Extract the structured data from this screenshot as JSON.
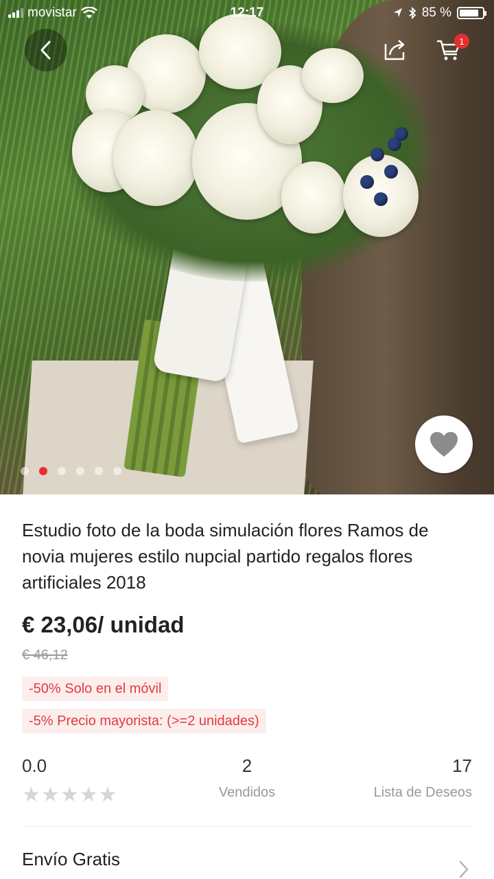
{
  "status_bar": {
    "carrier": "movistar",
    "time": "12:17",
    "battery": "85 %",
    "battery_level": 0.85
  },
  "header": {
    "cart_count": "1",
    "back_icon": "chevron-left-icon",
    "share_icon": "share-icon",
    "cart_icon": "cart-icon"
  },
  "gallery": {
    "image_count": 6,
    "active_index": 1,
    "favorite_icon": "heart-icon"
  },
  "product": {
    "title": "Estudio foto de la boda simulación flores Ramos de novia mujeres estilo nupcial partido regalos flores artificiales 2018",
    "price": "€ 23,06/ unidad",
    "original_price": "€ 46,12",
    "promotions": [
      "-50% Solo en el móvil",
      "-5% Precio mayorista: (>=2 unidades)"
    ]
  },
  "stats": {
    "rating": "0.0",
    "rating_value": 0,
    "sold_count": "2",
    "sold_label": "Vendidos",
    "wishlist_count": "17",
    "wishlist_label": "Lista de Deseos"
  },
  "shipping": {
    "label": "Envío Gratis"
  },
  "colors": {
    "accent": "#e62e2e",
    "promo_bg": "#fdeeee",
    "promo_text": "#e23b3b"
  }
}
